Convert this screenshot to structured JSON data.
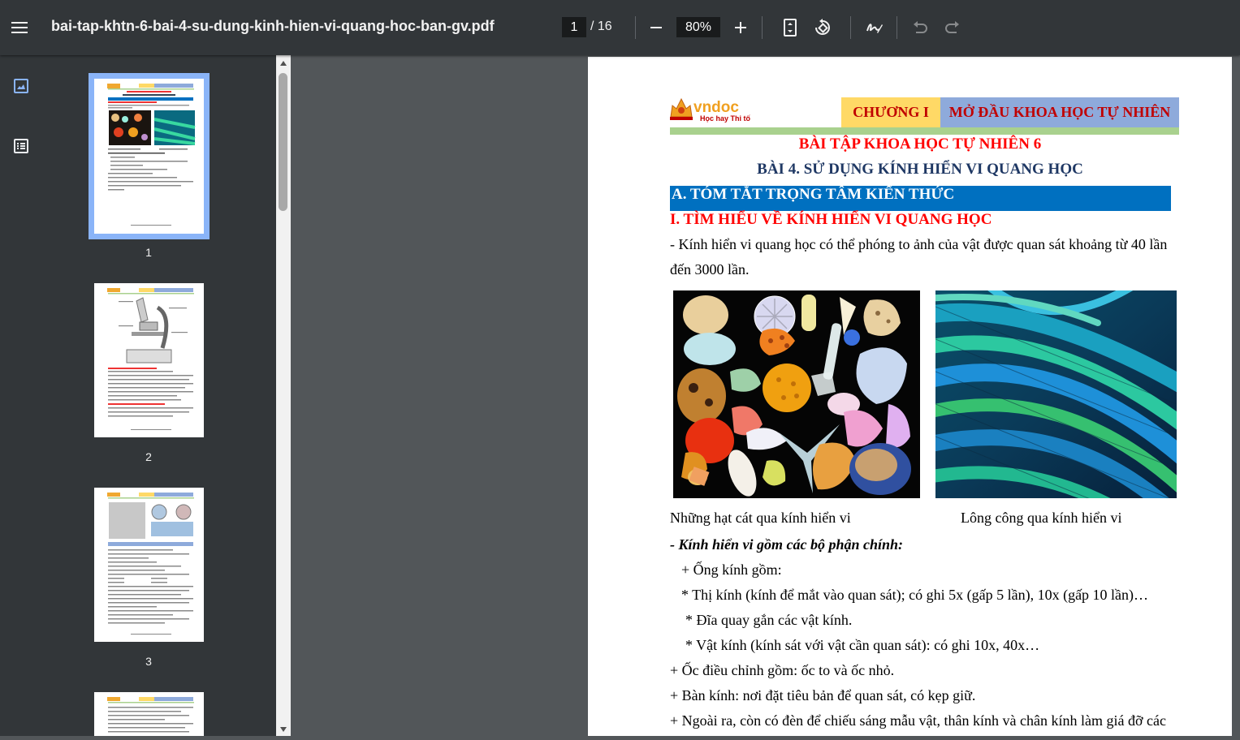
{
  "toolbar": {
    "filename": "bai-tap-khtn-6-bai-4-su-dung-kinh-hien-vi-quang-hoc-ban-gv.pdf",
    "current_page": "1",
    "page_total": "/ 16",
    "zoom": "80%"
  },
  "sidebar": {
    "thumbnails": [
      {
        "number": "1",
        "selected": true
      },
      {
        "number": "2",
        "selected": false
      },
      {
        "number": "3",
        "selected": false
      }
    ]
  },
  "page": {
    "logo_text": "vndoc",
    "logo_slogan": "Học hay Thi tốt",
    "chapter": "CHƯƠNG I",
    "chapter_title": "MỞ ĐẦU KHOA HỌC TỰ NHIÊN",
    "title1": "BÀI TẬP KHOA HỌC TỰ NHIÊN 6",
    "title2": "BÀI 4. SỬ DỤNG KÍNH HIỂN VI QUANG HỌC",
    "section_a": "A. TÓM TẮT TRỌNG TÂM KIẾN THỨC",
    "section_i": "I. TÌM HIỂU VỀ KÍNH HIỂN VI QUANG HỌC",
    "p1_line1": "- Kính hiển vi quang học có thể phóng to ảnh của vật được quan sát khoảng từ 40 lần",
    "p1_line2": "đến 3000 lần.",
    "caption1": "Những hạt cát qua kính hiển vi",
    "caption2": "Lông công qua kính hiển vi",
    "parts_heading": "- Kính hiển vi gồm các bộ phận chính:",
    "line_ong_kinh": "+ Ống kính gồm:",
    "line_thi_kinh": "* Thị kính (kính để mắt vào quan sát); có ghi 5x (gấp 5 lần), 10x (gấp 10 lần)…",
    "line_dia_quay": "* Đĩa quay gắn các vật kính.",
    "line_vat_kinh": "* Vật kính (kính sát với vật cần quan sát): có ghi 10x, 40x…",
    "line_oc": "+ Ốc điều chỉnh gồm: ốc to và ốc nhỏ.",
    "line_ban_kinh": "+ Bàn kính: nơi đặt tiêu bản để quan sát, có kẹp giữ.",
    "line_ngoai_ra": "+ Ngoài ra, còn có đèn để chiếu sáng mẫu vật, thân kính và chân kính làm giá đỡ các"
  }
}
